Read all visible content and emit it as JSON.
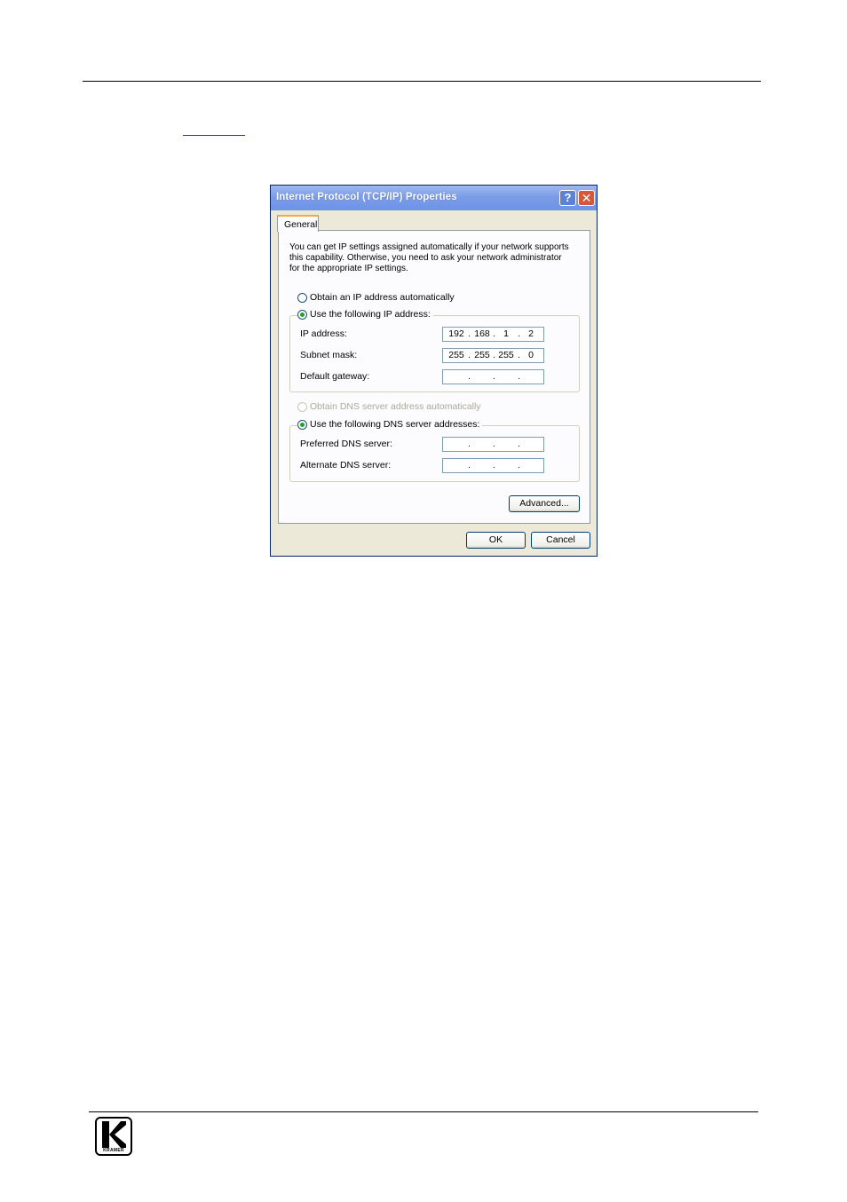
{
  "dialog": {
    "title": "Internet Protocol (TCP/IP) Properties",
    "help_glyph": "?",
    "close_glyph": "✕",
    "tab_label": "General",
    "intro": "You can get IP settings assigned automatically if your network supports this capability. Otherwise, you need to ask your network administrator for the appropriate IP settings.",
    "ip_mode": {
      "auto_label": "Obtain an IP address automatically",
      "manual_label": "Use the following IP address:",
      "selected": "manual"
    },
    "ip_fields": {
      "ip_label": "IP address:",
      "ip_value": [
        "192",
        "168",
        "1",
        "2"
      ],
      "mask_label": "Subnet mask:",
      "mask_value": [
        "255",
        "255",
        "255",
        "0"
      ],
      "gateway_label": "Default gateway:",
      "gateway_value": [
        "",
        "",
        "",
        ""
      ]
    },
    "dns_mode": {
      "auto_label": "Obtain DNS server address automatically",
      "manual_label": "Use the following DNS server addresses:",
      "selected": "manual"
    },
    "dns_fields": {
      "preferred_label": "Preferred DNS server:",
      "preferred_value": [
        "",
        "",
        "",
        ""
      ],
      "alternate_label": "Alternate DNS server:",
      "alternate_value": [
        "",
        "",
        "",
        ""
      ]
    },
    "advanced_label": "Advanced...",
    "ok_label": "OK",
    "cancel_label": "Cancel"
  },
  "footer": {
    "logo_text": "KRAMER"
  },
  "colors": {
    "titlebar": "#7b9de8",
    "dialog_bg": "#ece9d8",
    "radio_checked": "#21a121",
    "link": "#1a2fd0"
  }
}
